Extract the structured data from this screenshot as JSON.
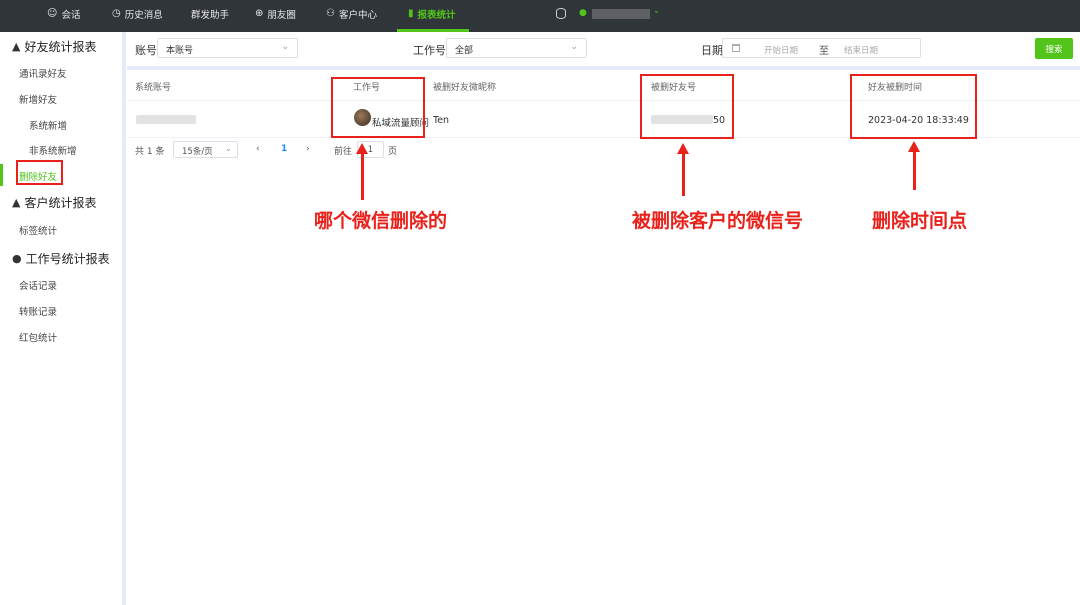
{
  "topnav": {
    "items": [
      {
        "label": "会话",
        "icon": "chat-icon"
      },
      {
        "label": "历史消息",
        "icon": "clock-icon"
      },
      {
        "label": "群发助手",
        "icon": ""
      },
      {
        "label": "朋友圈",
        "icon": "globe-icon"
      },
      {
        "label": "客户中心",
        "icon": "person-icon"
      },
      {
        "label": "报表统计",
        "icon": "bar-chart-icon",
        "active": true
      }
    ],
    "accent": "#52c41a"
  },
  "sidebar": {
    "groups": [
      {
        "title": "好友统计报表",
        "icon": "person-icon",
        "items": [
          "通讯录好友",
          "新增好友",
          "系统新增",
          "非系统新增",
          "删除好友"
        ]
      },
      {
        "title": "客户统计报表",
        "icon": "person-icon",
        "items": [
          "标签统计"
        ]
      },
      {
        "title": "工作号统计报表",
        "icon": "wechat-icon",
        "items": [
          "会话记录",
          "转账记录",
          "红包统计"
        ]
      }
    ],
    "active_item": "删除好友"
  },
  "filters": {
    "account_label": "账号",
    "account_value": "本账号",
    "worknum_label": "工作号",
    "worknum_value": "全部",
    "date_label": "日期",
    "date_start_placeholder": "开始日期",
    "date_end_placeholder": "结束日期",
    "date_separator": "至",
    "search_label": "搜索"
  },
  "table": {
    "columns": [
      "系统账号",
      "工作号",
      "被删好友微昵称",
      "被删好友号",
      "好友被删时间"
    ],
    "rows": [
      {
        "work_number": "私域流量顾问",
        "nickname": "Ten",
        "friend_id_suffix": "50",
        "deleted_time": "2023-04-20 18:33:49"
      }
    ]
  },
  "pagination": {
    "total": "共 1 条",
    "page_size": "15条/页",
    "prev": "‹",
    "current": "1",
    "next": "›",
    "goto_label": "前往",
    "goto_value": "1",
    "goto_suffix": "页"
  },
  "annotations": {
    "work_number_note": "哪个微信删除的",
    "friend_id_note": "被删除客户的微信号",
    "time_note": "删除时间点",
    "color": "#e8221b"
  }
}
